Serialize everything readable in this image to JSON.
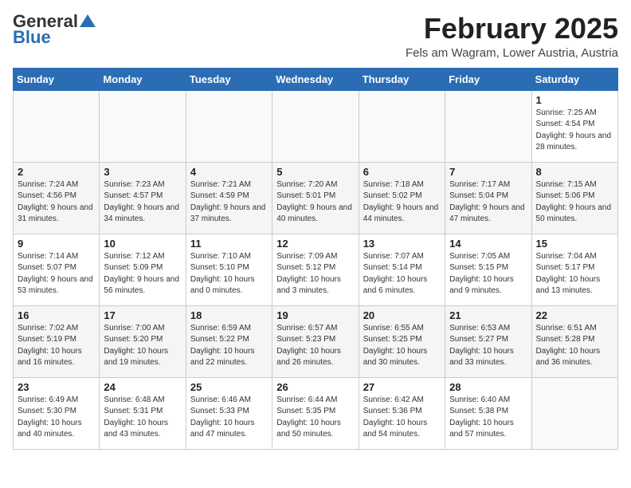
{
  "header": {
    "logo_general": "General",
    "logo_blue": "Blue",
    "month": "February 2025",
    "location": "Fels am Wagram, Lower Austria, Austria"
  },
  "weekdays": [
    "Sunday",
    "Monday",
    "Tuesday",
    "Wednesday",
    "Thursday",
    "Friday",
    "Saturday"
  ],
  "weeks": [
    [
      {
        "day": "",
        "info": ""
      },
      {
        "day": "",
        "info": ""
      },
      {
        "day": "",
        "info": ""
      },
      {
        "day": "",
        "info": ""
      },
      {
        "day": "",
        "info": ""
      },
      {
        "day": "",
        "info": ""
      },
      {
        "day": "1",
        "info": "Sunrise: 7:25 AM\nSunset: 4:54 PM\nDaylight: 9 hours and 28 minutes."
      }
    ],
    [
      {
        "day": "2",
        "info": "Sunrise: 7:24 AM\nSunset: 4:56 PM\nDaylight: 9 hours and 31 minutes."
      },
      {
        "day": "3",
        "info": "Sunrise: 7:23 AM\nSunset: 4:57 PM\nDaylight: 9 hours and 34 minutes."
      },
      {
        "day": "4",
        "info": "Sunrise: 7:21 AM\nSunset: 4:59 PM\nDaylight: 9 hours and 37 minutes."
      },
      {
        "day": "5",
        "info": "Sunrise: 7:20 AM\nSunset: 5:01 PM\nDaylight: 9 hours and 40 minutes."
      },
      {
        "day": "6",
        "info": "Sunrise: 7:18 AM\nSunset: 5:02 PM\nDaylight: 9 hours and 44 minutes."
      },
      {
        "day": "7",
        "info": "Sunrise: 7:17 AM\nSunset: 5:04 PM\nDaylight: 9 hours and 47 minutes."
      },
      {
        "day": "8",
        "info": "Sunrise: 7:15 AM\nSunset: 5:06 PM\nDaylight: 9 hours and 50 minutes."
      }
    ],
    [
      {
        "day": "9",
        "info": "Sunrise: 7:14 AM\nSunset: 5:07 PM\nDaylight: 9 hours and 53 minutes."
      },
      {
        "day": "10",
        "info": "Sunrise: 7:12 AM\nSunset: 5:09 PM\nDaylight: 9 hours and 56 minutes."
      },
      {
        "day": "11",
        "info": "Sunrise: 7:10 AM\nSunset: 5:10 PM\nDaylight: 10 hours and 0 minutes."
      },
      {
        "day": "12",
        "info": "Sunrise: 7:09 AM\nSunset: 5:12 PM\nDaylight: 10 hours and 3 minutes."
      },
      {
        "day": "13",
        "info": "Sunrise: 7:07 AM\nSunset: 5:14 PM\nDaylight: 10 hours and 6 minutes."
      },
      {
        "day": "14",
        "info": "Sunrise: 7:05 AM\nSunset: 5:15 PM\nDaylight: 10 hours and 9 minutes."
      },
      {
        "day": "15",
        "info": "Sunrise: 7:04 AM\nSunset: 5:17 PM\nDaylight: 10 hours and 13 minutes."
      }
    ],
    [
      {
        "day": "16",
        "info": "Sunrise: 7:02 AM\nSunset: 5:19 PM\nDaylight: 10 hours and 16 minutes."
      },
      {
        "day": "17",
        "info": "Sunrise: 7:00 AM\nSunset: 5:20 PM\nDaylight: 10 hours and 19 minutes."
      },
      {
        "day": "18",
        "info": "Sunrise: 6:59 AM\nSunset: 5:22 PM\nDaylight: 10 hours and 22 minutes."
      },
      {
        "day": "19",
        "info": "Sunrise: 6:57 AM\nSunset: 5:23 PM\nDaylight: 10 hours and 26 minutes."
      },
      {
        "day": "20",
        "info": "Sunrise: 6:55 AM\nSunset: 5:25 PM\nDaylight: 10 hours and 30 minutes."
      },
      {
        "day": "21",
        "info": "Sunrise: 6:53 AM\nSunset: 5:27 PM\nDaylight: 10 hours and 33 minutes."
      },
      {
        "day": "22",
        "info": "Sunrise: 6:51 AM\nSunset: 5:28 PM\nDaylight: 10 hours and 36 minutes."
      }
    ],
    [
      {
        "day": "23",
        "info": "Sunrise: 6:49 AM\nSunset: 5:30 PM\nDaylight: 10 hours and 40 minutes."
      },
      {
        "day": "24",
        "info": "Sunrise: 6:48 AM\nSunset: 5:31 PM\nDaylight: 10 hours and 43 minutes."
      },
      {
        "day": "25",
        "info": "Sunrise: 6:46 AM\nSunset: 5:33 PM\nDaylight: 10 hours and 47 minutes."
      },
      {
        "day": "26",
        "info": "Sunrise: 6:44 AM\nSunset: 5:35 PM\nDaylight: 10 hours and 50 minutes."
      },
      {
        "day": "27",
        "info": "Sunrise: 6:42 AM\nSunset: 5:36 PM\nDaylight: 10 hours and 54 minutes."
      },
      {
        "day": "28",
        "info": "Sunrise: 6:40 AM\nSunset: 5:38 PM\nDaylight: 10 hours and 57 minutes."
      },
      {
        "day": "",
        "info": ""
      }
    ]
  ]
}
